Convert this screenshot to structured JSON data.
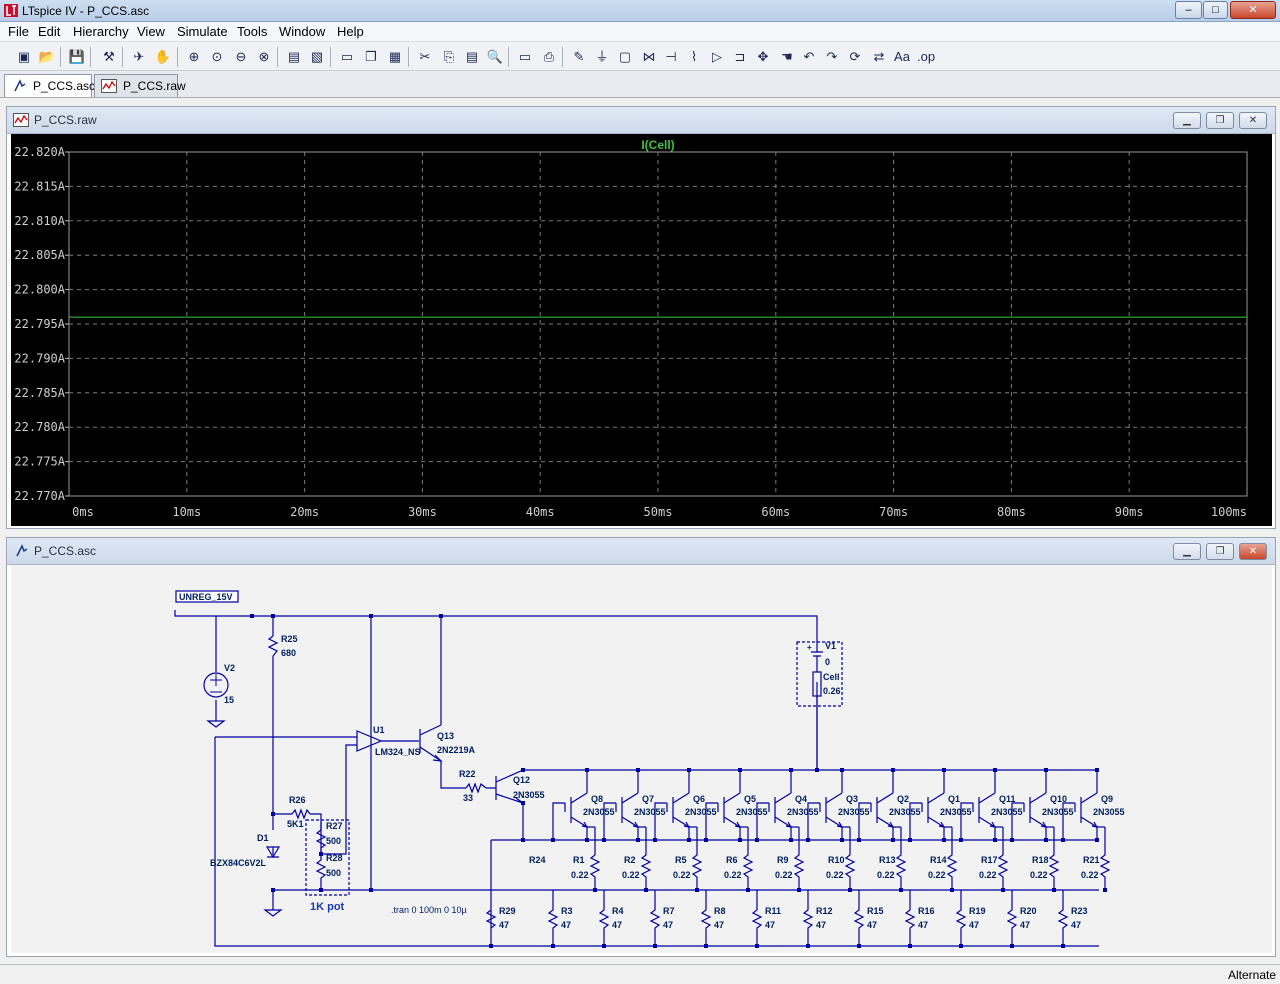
{
  "window": {
    "title": "LTspice IV - P_CCS.asc",
    "controls": {
      "minimize": "–",
      "maximize": "□",
      "close": "✕"
    }
  },
  "menu": [
    "File",
    "Edit",
    "Hierarchy",
    "View",
    "Simulate",
    "Tools",
    "Window",
    "Help"
  ],
  "toolbar_icons": [
    "new-schematic-icon",
    "open-icon",
    "save-icon",
    "control-panel-icon",
    "run-icon",
    "halt-icon",
    "zoom-in-icon",
    "zoom-area-icon",
    "zoom-out-icon",
    "zoom-cancel-icon",
    "autorange-icon",
    "fit-icon",
    "tile-horizontal-icon",
    "cascade-icon",
    "close-all-icon",
    "cut-icon",
    "copy-icon",
    "paste-icon",
    "find-icon",
    "print-preview-icon",
    "print-icon",
    "wire-icon",
    "ground-icon",
    "label-icon",
    "resistor-icon",
    "capacitor-icon",
    "inductor-icon",
    "diode-icon",
    "component-icon",
    "move-icon",
    "drag-icon",
    "undo-icon",
    "redo-icon",
    "rotate-icon",
    "mirror-icon",
    "text-icon",
    "spice-directive-icon"
  ],
  "tabs": [
    {
      "label": "P_CCS.asc",
      "icon": "schematic-icon"
    },
    {
      "label": "P_CCS.raw",
      "icon": "waveform-icon"
    }
  ],
  "waveform": {
    "title": "P_CCS.raw",
    "chart_data": {
      "type": "line",
      "title": "I(Cell)",
      "series": [
        {
          "name": "I(Cell)",
          "color": "#3ec23e",
          "x": [
            "0ms",
            "100ms"
          ],
          "values": [
            22.796,
            22.796
          ]
        }
      ],
      "yticks": [
        "22.820A",
        "22.815A",
        "22.810A",
        "22.805A",
        "22.800A",
        "22.795A",
        "22.790A",
        "22.785A",
        "22.780A",
        "22.775A",
        "22.770A"
      ],
      "ylim": [
        22.77,
        22.82
      ],
      "xticks": [
        "0ms",
        "10ms",
        "20ms",
        "30ms",
        "40ms",
        "50ms",
        "60ms",
        "70ms",
        "80ms",
        "90ms",
        "100ms"
      ],
      "xlim": [
        0,
        100
      ],
      "grid": true,
      "background": "#000000"
    }
  },
  "schematic": {
    "title": "P_CCS.asc",
    "labels": {
      "net": "UNREG_15V",
      "v2": "V2",
      "v2_val": "15",
      "r25": "R25",
      "r25_val": "680",
      "u1": "U1",
      "u1_val": "LM324_NS",
      "q13": "Q13",
      "q13_val": "2N2219A",
      "r22": "R22",
      "r22_val": "33",
      "q12": "Q12",
      "q12_val": "2N3055",
      "r26": "R26",
      "r26_val": "5K1",
      "d1": "D1",
      "d1_val": "BZX84C6V2L",
      "r27": "R27",
      "r27_val": "500",
      "r28": "R28",
      "r28_val": "500",
      "pot": "1K pot",
      "v1": "V1",
      "v1_val": "0",
      "cell": "Cell",
      "cell_val": "0.26",
      "r24": "R24",
      "r29": "R29",
      "directive": ".tran 0 100m 0 10µ",
      "plus": "+"
    },
    "transistors": [
      "Q8",
      "Q7",
      "Q6",
      "Q5",
      "Q4",
      "Q3",
      "Q2",
      "Q1",
      "Q11",
      "Q10",
      "Q9"
    ],
    "transistor_model": "2N3055",
    "emitter_resistors": [
      "R1",
      "R2",
      "R5",
      "R6",
      "R9",
      "R10",
      "R13",
      "R14",
      "R17",
      "R18",
      "R21"
    ],
    "emitter_value": "0.22",
    "base_resistors": [
      "R3",
      "R4",
      "R7",
      "R8",
      "R11",
      "R12",
      "R15",
      "R16",
      "R19",
      "R20",
      "R23"
    ],
    "base_value": "47",
    "wire_color": "#0000a0",
    "text_color": "#002060"
  },
  "status": {
    "mode": "Alternate"
  }
}
